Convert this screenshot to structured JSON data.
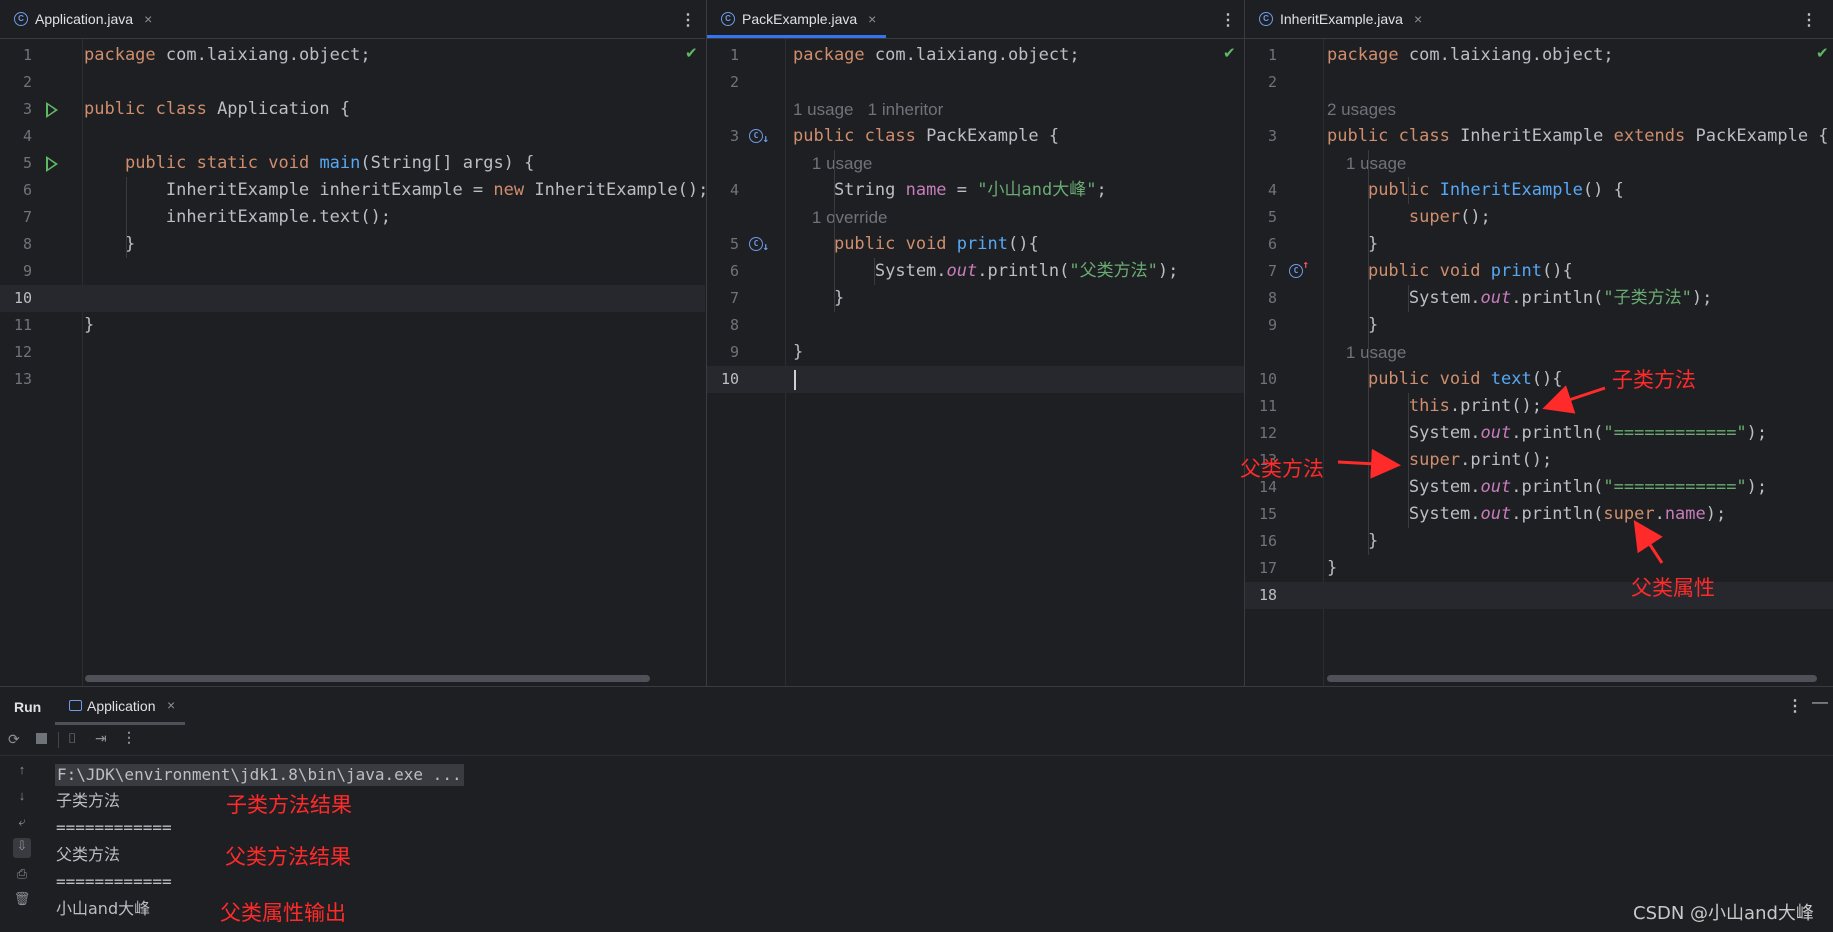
{
  "panes": [
    {
      "tab": "Application.java",
      "lines": [
        {
          "n": "1",
          "html": "<span class=kw>package</span> com.laixiang.object;"
        },
        {
          "n": "2",
          "html": ""
        },
        {
          "n": "3",
          "html": "<span class=kw>public class</span> Application {",
          "run": true
        },
        {
          "n": "4",
          "html": ""
        },
        {
          "n": "5",
          "html": "    <span class=kw>public static void</span> <span class=fn>main</span>(String[] args) {",
          "run": true
        },
        {
          "n": "6",
          "html": "        InheritExample inheritExample = <span class=kw>new</span> InheritExample();"
        },
        {
          "n": "7",
          "html": "        inheritExample.text();"
        },
        {
          "n": "8",
          "html": "    }"
        },
        {
          "n": "9",
          "html": ""
        },
        {
          "n": "10",
          "html": "",
          "cur": true
        },
        {
          "n": "11",
          "html": "}"
        },
        {
          "n": "12",
          "html": ""
        },
        {
          "n": "13",
          "html": ""
        }
      ]
    },
    {
      "tab": "PackExample.java",
      "lines": [
        {
          "n": "1",
          "html": "<span class=kw>package</span> com.laixiang.object;"
        },
        {
          "n": "2",
          "html": ""
        },
        {
          "n": "",
          "hint": "1 usage   1 inheritor"
        },
        {
          "n": "3",
          "html": "<span class=kw>public class</span> PackExample {",
          "gic": "down"
        },
        {
          "n": "",
          "hint": "    1 usage"
        },
        {
          "n": "4",
          "html": "    String <span class=fld>name</span> = <span class=str>\"小山and大峰\"</span>;"
        },
        {
          "n": "",
          "hint": "    1 override"
        },
        {
          "n": "5",
          "html": "    <span class=kw>public void</span> <span class=fn>print</span>(){",
          "gic": "down"
        },
        {
          "n": "6",
          "html": "        System.<span class=ital>out</span>.println(<span class=str>\"父类方法\"</span>);"
        },
        {
          "n": "7",
          "html": "    }"
        },
        {
          "n": "8",
          "html": ""
        },
        {
          "n": "9",
          "html": "}"
        },
        {
          "n": "10",
          "html": "",
          "cur": true
        }
      ]
    },
    {
      "tab": "InheritExample.java",
      "lines": [
        {
          "n": "1",
          "html": "<span class=kw>package</span> com.laixiang.object;"
        },
        {
          "n": "2",
          "html": ""
        },
        {
          "n": "",
          "hint": "2 usages"
        },
        {
          "n": "3",
          "html": "<span class=kw>public class</span> InheritExample <span class=kw>extends</span> PackExample {"
        },
        {
          "n": "",
          "hint": "    1 usage"
        },
        {
          "n": "4",
          "html": "    <span class=kw>public</span> <span class=fn>InheritExample</span>() {"
        },
        {
          "n": "5",
          "html": "        <span class=kw>super</span>();"
        },
        {
          "n": "6",
          "html": "    }"
        },
        {
          "n": "7",
          "html": "    <span class=kw>public void</span> <span class=fn>print</span>(){",
          "gic": "up"
        },
        {
          "n": "8",
          "html": "        System.<span class=ital>out</span>.println(<span class=str>\"子类方法\"</span>);"
        },
        {
          "n": "9",
          "html": "    }"
        },
        {
          "n": "",
          "hint": "    1 usage"
        },
        {
          "n": "10",
          "html": "    <span class=kw>public void</span> <span class=fn>text</span>(){"
        },
        {
          "n": "11",
          "html": "        <span class=kw>this</span>.print();"
        },
        {
          "n": "12",
          "html": "        System.<span class=ital>out</span>.println(<span class=str>\"============\"</span>);"
        },
        {
          "n": "13",
          "html": "        <span class=kw>super</span>.print();"
        },
        {
          "n": "14",
          "html": "        System.<span class=ital>out</span>.println(<span class=str>\"============\"</span>);"
        },
        {
          "n": "15",
          "html": "        System.<span class=ital>out</span>.println(<span class=kw>super</span>.<span class=fld>name</span>);"
        },
        {
          "n": "16",
          "html": "    }"
        },
        {
          "n": "17",
          "html": "}"
        },
        {
          "n": "18",
          "html": "",
          "cur": true
        }
      ]
    }
  ],
  "annotations": {
    "child_method": "子类方法",
    "parent_method": "父类方法",
    "parent_field": "父类属性"
  },
  "run": {
    "label": "Run",
    "tab": "Application",
    "output": [
      "F:\\JDK\\environment\\jdk1.8\\bin\\java.exe ...",
      "子类方法",
      "============",
      "父类方法",
      "============",
      "小山and大峰"
    ],
    "ann_child_result": "子类方法结果",
    "ann_parent_result": "父类方法结果",
    "ann_parent_field_output": "父类属性输出"
  },
  "watermark": "CSDN @小山and大峰"
}
